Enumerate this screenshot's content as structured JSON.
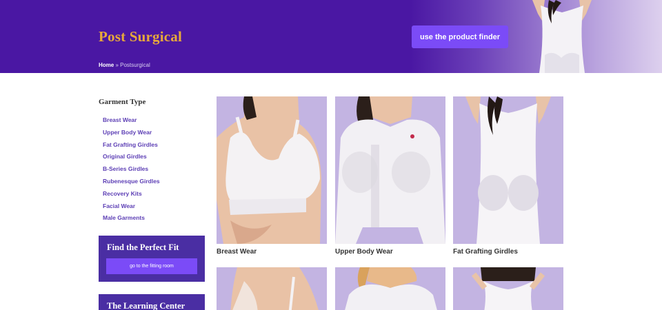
{
  "header": {
    "title": "Post Surgical",
    "finder_button": "use the product finder",
    "breadcrumb_home": "Home",
    "breadcrumb_separator": " » ",
    "breadcrumb_current": "Postsurgical"
  },
  "sidebar": {
    "heading": "Garment Type",
    "items": [
      {
        "label": "Breast Wear"
      },
      {
        "label": "Upper Body Wear"
      },
      {
        "label": "Fat Grafting Girdles"
      },
      {
        "label": "Original Girdles"
      },
      {
        "label": "B-Series Girdles"
      },
      {
        "label": "Rubenesque Girdles"
      },
      {
        "label": "Recovery Kits"
      },
      {
        "label": "Facial Wear"
      },
      {
        "label": "Male Garments"
      }
    ],
    "fit_box": {
      "title": "Find the Perfect Fit",
      "button": "go to the fitting room"
    },
    "learning_box": {
      "title": "The Learning Center"
    }
  },
  "products": [
    {
      "label": "Breast Wear"
    },
    {
      "label": "Upper Body Wear"
    },
    {
      "label": "Fat Grafting Girdles"
    }
  ],
  "colors": {
    "brand_purple": "#4a17a3",
    "accent_button": "#7b4bf7",
    "title_gold": "#e8a93a",
    "link_purple": "#5d3fb5",
    "tile_background": "#c3b4e2"
  }
}
